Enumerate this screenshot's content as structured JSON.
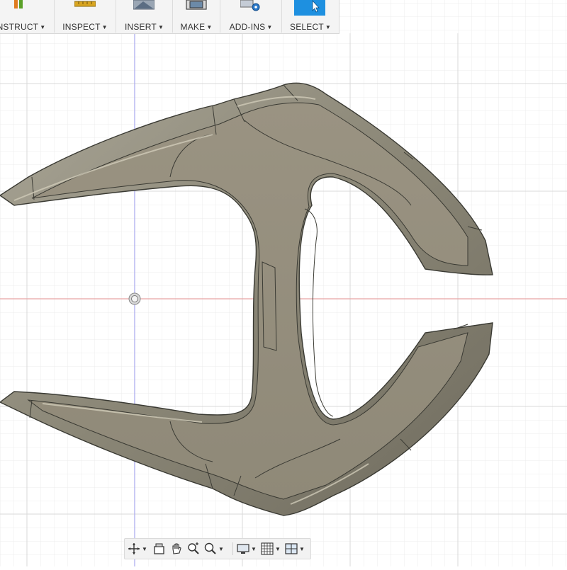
{
  "toolbar": {
    "groups": [
      {
        "label": "NSTRUCT",
        "icon": "construct-plane-icon"
      },
      {
        "label": "INSPECT",
        "icon": "measure-icon"
      },
      {
        "label": "INSERT",
        "icon": "insert-image-icon"
      },
      {
        "label": "MAKE",
        "icon": "make-3d-print-icon"
      },
      {
        "label": "ADD-INS",
        "icon": "add-ins-gear-icon"
      },
      {
        "label": "SELECT",
        "icon": "select-cursor-icon"
      }
    ]
  },
  "navbar": {
    "items": [
      "orbit-icon",
      "look-at-icon",
      "pan-hand-icon",
      "zoom-window-icon",
      "fit-zoom-icon",
      "display-settings-icon",
      "grid-settings-icon",
      "viewports-icon"
    ]
  },
  "colors": {
    "toolbar_bg": "#f4f4f4",
    "grid_line": "#e2e2e2",
    "x_axis": "#e8b4b4",
    "y_axis": "#b4b4ee",
    "part_fill": "#958e7e",
    "part_rim": "#7d7969",
    "select_accent": "#1e90e0"
  }
}
